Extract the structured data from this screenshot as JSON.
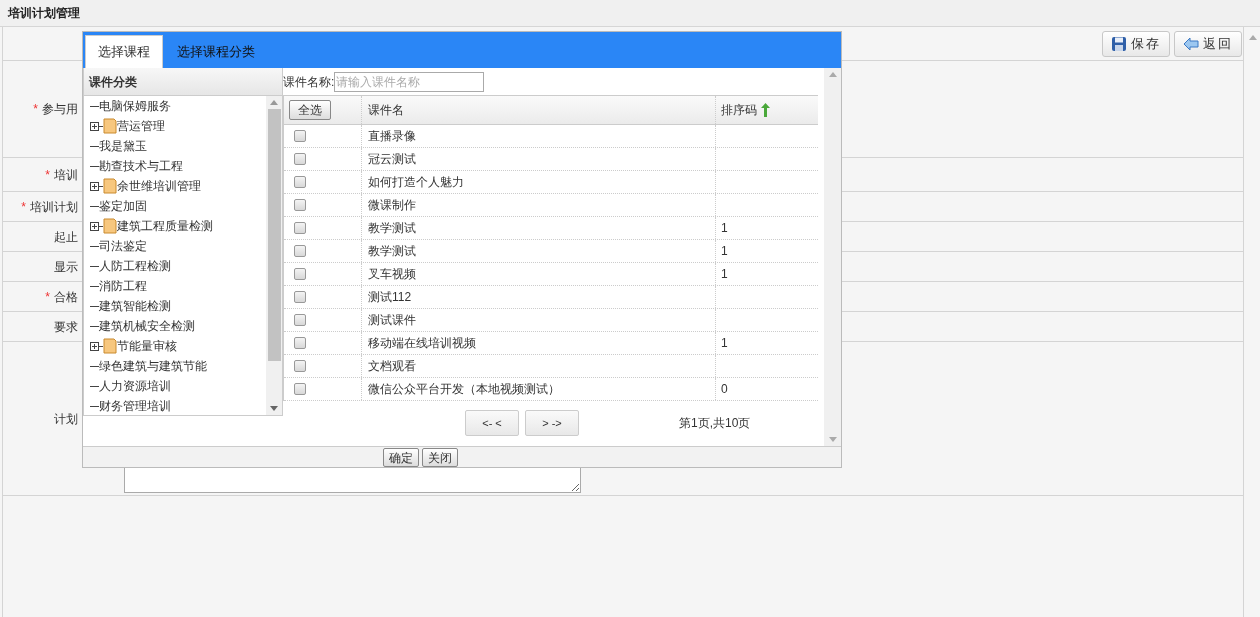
{
  "page_title": "培训计划管理",
  "toolbar": {
    "buttons": [
      {
        "kind": "save",
        "label": "保存"
      },
      {
        "kind": "back",
        "label": "返回"
      }
    ]
  },
  "form": {
    "rows": [
      {
        "label": "参与用",
        "required_mark": "*"
      },
      {
        "label": "培训",
        "required_mark": "*"
      },
      {
        "label": "培训计划",
        "required_mark": "*"
      },
      {
        "label": "起止"
      },
      {
        "label": "显示"
      },
      {
        "label": "合格",
        "required_mark": "*"
      },
      {
        "label": "要求"
      },
      {
        "label": "计划",
        "kind": "textarea"
      }
    ]
  },
  "dialog": {
    "tabs": [
      {
        "label": "选择课程",
        "selected": true
      },
      {
        "label": "选择课程分类",
        "selected": false
      }
    ],
    "tree": {
      "title": "课件分类",
      "items": [
        {
          "label": "电脑保姆服务",
          "kind": "leaf"
        },
        {
          "label": "营运管理",
          "kind": "folder",
          "expanded": false
        },
        {
          "label": "我是黛玉",
          "kind": "leaf"
        },
        {
          "label": "勘查技术与工程",
          "kind": "leaf"
        },
        {
          "label": "余世维培训管理",
          "kind": "folder",
          "expanded": false
        },
        {
          "label": "鉴定加固",
          "kind": "leaf"
        },
        {
          "label": "建筑工程质量检测",
          "kind": "folder",
          "expanded": false
        },
        {
          "label": "司法鉴定",
          "kind": "leaf"
        },
        {
          "label": "人防工程检测",
          "kind": "leaf"
        },
        {
          "label": "消防工程",
          "kind": "leaf"
        },
        {
          "label": "建筑智能检测",
          "kind": "leaf"
        },
        {
          "label": "建筑机械安全检测",
          "kind": "leaf"
        },
        {
          "label": "节能量审核",
          "kind": "folder",
          "expanded": false
        },
        {
          "label": "绿色建筑与建筑节能",
          "kind": "leaf"
        },
        {
          "label": "人力资源培训",
          "kind": "leaf"
        },
        {
          "label": "财务管理培训",
          "kind": "leaf"
        }
      ]
    },
    "search": {
      "label": "课件名称:",
      "placeholder": "请输入课件名称"
    },
    "table": {
      "select_all": "全选",
      "columns": [
        "课件名",
        "排序码"
      ],
      "rows": [
        {
          "checked": false,
          "name": "直播录像"
        },
        {
          "checked": false,
          "name": "冠云测试"
        },
        {
          "checked": false,
          "name": "如何打造个人魅力"
        },
        {
          "checked": false,
          "name": "微课制作"
        },
        {
          "checked": false,
          "name": "教学测试",
          "sort": "1"
        },
        {
          "checked": false,
          "name": "教学测试",
          "sort": "1"
        },
        {
          "checked": false,
          "name": "叉车视频",
          "sort": "1"
        },
        {
          "checked": false,
          "name": "测试112"
        },
        {
          "checked": false,
          "name": "测试课件"
        },
        {
          "checked": false,
          "name": "移动端在线培训视频",
          "sort": "1"
        },
        {
          "checked": false,
          "name": "文档观看"
        },
        {
          "checked": false,
          "name": "微信公众平台开发（本地视频测试）",
          "sort": "0"
        }
      ]
    },
    "pagination": {
      "prev": "<- <",
      "next": "> ->",
      "info": "第1页,共10页"
    },
    "footer_buttons": [
      "确定",
      "关闭"
    ]
  }
}
